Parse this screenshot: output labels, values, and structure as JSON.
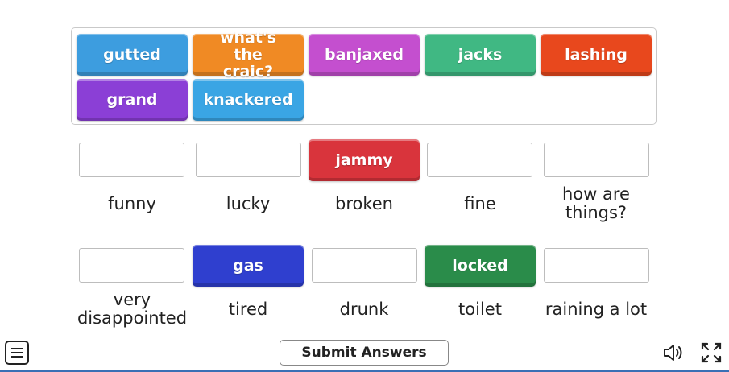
{
  "bank_tiles": [
    {
      "label": "gutted",
      "color": "#3d9ddf"
    },
    {
      "label": "what's the craic?",
      "color": "#f08a24"
    },
    {
      "label": "banjaxed",
      "color": "#c44fcf"
    },
    {
      "label": "jacks",
      "color": "#40b883"
    },
    {
      "label": "lashing",
      "color": "#e8481d"
    },
    {
      "label": "grand",
      "color": "#8b3fd6"
    },
    {
      "label": "knackered",
      "color": "#3aa5e4"
    }
  ],
  "row1": {
    "placed": {
      "label": "jammy",
      "color": "#d9343c"
    },
    "labels": [
      "funny",
      "lucky",
      "broken",
      "fine",
      "how are things?"
    ]
  },
  "row2": {
    "placed_gas": {
      "label": "gas",
      "color": "#2f3fcf"
    },
    "placed_locked": {
      "label": "locked",
      "color": "#2a8c4a"
    },
    "labels": [
      "very disappointed",
      "tired",
      "drunk",
      "toilet",
      "raining a lot"
    ]
  },
  "footer": {
    "submit_label": "Submit Answers",
    "menu_icon": "hamburger-menu-icon",
    "sound_icon": "speaker-icon",
    "fullscreen_icon": "fullscreen-icon"
  }
}
